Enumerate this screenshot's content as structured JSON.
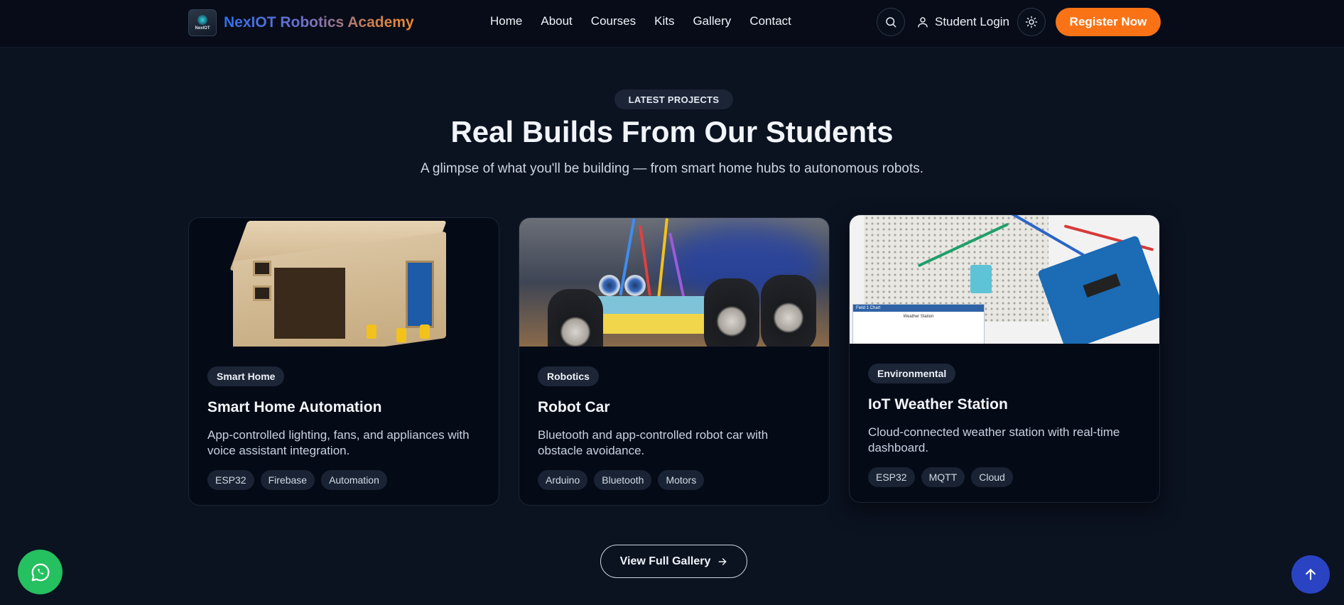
{
  "nav": {
    "logo_text": "NexIOT",
    "brand": "NexIOT Robotics Academy",
    "links": [
      "Home",
      "About",
      "Courses",
      "Kits",
      "Gallery",
      "Contact"
    ],
    "login": "Student Login",
    "register": "Register Now",
    "icons": {
      "search": "search-icon",
      "user": "user-icon",
      "theme": "sun-icon"
    }
  },
  "section": {
    "pill": "LATEST PROJECTS",
    "title": "Real Builds From Our Students",
    "subtitle": "A glimpse of what you'll be building — from smart home hubs to autonomous robots."
  },
  "cards": [
    {
      "tag": "Smart Home",
      "title": "Smart Home Automation",
      "desc": "App-controlled lighting, fans, and appliances with voice assistant integration.",
      "chips": [
        "ESP32",
        "Firebase",
        "Automation"
      ]
    },
    {
      "tag": "Robotics",
      "title": "Robot Car",
      "desc": "Bluetooth and app-controlled robot car with obstacle avoidance.",
      "chips": [
        "Arduino",
        "Bluetooth",
        "Motors"
      ]
    },
    {
      "tag": "Environmental",
      "title": "IoT Weather Station",
      "desc": "Cloud-connected weather station with real-time dashboard.",
      "chips": [
        "ESP32",
        "MQTT",
        "Cloud"
      ],
      "chart_head": "Field 1 Chart",
      "chart_title": "Weather Station"
    }
  ],
  "gallery_button": "View Full Gallery",
  "floating": {
    "whatsapp": "whatsapp-icon",
    "scroll_top": "arrow-up-icon"
  },
  "colors": {
    "background": "#0b1220",
    "navbar": "#070c18",
    "accent": "#f97316",
    "whatsapp": "#25c05f",
    "scroll_top": "#2a43c2"
  }
}
